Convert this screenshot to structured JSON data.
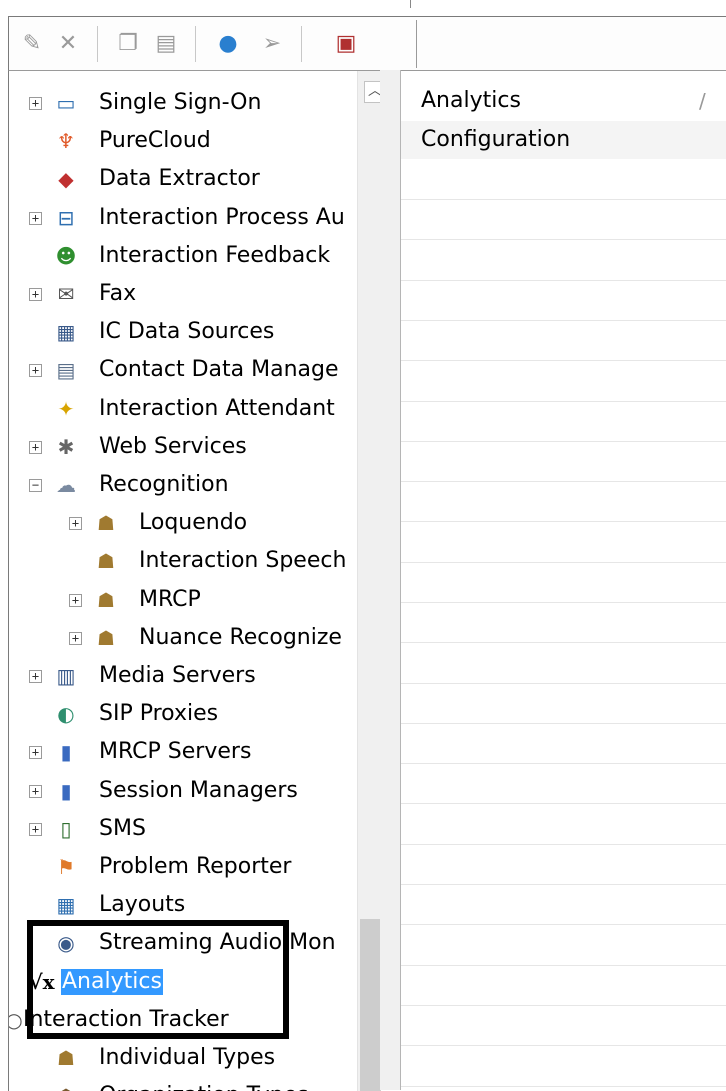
{
  "toolbar": {
    "icons": [
      "edit-icon",
      "delete-icon",
      "copy-icon",
      "paste-icon",
      "globe-icon",
      "flag-icon",
      "report-icon"
    ]
  },
  "tree": {
    "items": [
      {
        "label": "Single Sign-On",
        "icon": "sign-on-icon",
        "expandable": true
      },
      {
        "label": "PureCloud",
        "icon": "purecloud-icon",
        "expandable": false
      },
      {
        "label": "Data Extractor",
        "icon": "data-extractor-icon",
        "expandable": false
      },
      {
        "label": "Interaction Process Au",
        "icon": "process-flow-icon",
        "expandable": true
      },
      {
        "label": "Interaction Feedback",
        "icon": "feedback-users-icon",
        "expandable": false
      },
      {
        "label": "Fax",
        "icon": "fax-icon",
        "expandable": true
      },
      {
        "label": "IC Data Sources",
        "icon": "data-sources-icon",
        "expandable": false
      },
      {
        "label": "Contact Data Manage",
        "icon": "contact-data-icon",
        "expandable": true
      },
      {
        "label": "Interaction Attendant",
        "icon": "attendant-icon",
        "expandable": false
      },
      {
        "label": "Web Services",
        "icon": "web-services-icon",
        "expandable": true
      },
      {
        "label": "Recognition",
        "icon": "recognition-icon",
        "expandable": true,
        "expanded": true
      },
      {
        "label": "Loquendo",
        "icon": "speech-user-icon",
        "expandable": true,
        "child": true
      },
      {
        "label": "Interaction Speech",
        "icon": "speech-user-icon",
        "expandable": false,
        "child": true
      },
      {
        "label": "MRCP",
        "icon": "speech-user-icon",
        "expandable": true,
        "child": true
      },
      {
        "label": "Nuance Recognize",
        "icon": "speech-user-icon",
        "expandable": true,
        "child": true
      },
      {
        "label": "Media Servers",
        "icon": "media-server-icon",
        "expandable": true
      },
      {
        "label": "SIP Proxies",
        "icon": "sip-proxy-icon",
        "expandable": false
      },
      {
        "label": "MRCP Servers",
        "icon": "server-icon",
        "expandable": true
      },
      {
        "label": "Session Managers",
        "icon": "server-icon",
        "expandable": true
      },
      {
        "label": "SMS",
        "icon": "phone-icon",
        "expandable": true
      },
      {
        "label": "Problem Reporter",
        "icon": "problem-reporter-icon",
        "expandable": false
      },
      {
        "label": "Layouts",
        "icon": "layouts-icon",
        "expandable": false
      },
      {
        "label": "Streaming Audio Mon",
        "icon": "streaming-audio-icon",
        "expandable": false
      },
      {
        "label": "Analytics",
        "icon": "sqrt-x-icon",
        "expandable": false,
        "selected": true
      },
      {
        "label": "Interaction Tracker",
        "icon": "tracker-icon",
        "expandable": false
      },
      {
        "label": "Individual Types",
        "icon": "individual-types-icon",
        "expandable": false
      },
      {
        "label": "Organization Types",
        "icon": "organization-types-icon",
        "expandable": false
      }
    ]
  },
  "list": {
    "header": "Analytics",
    "header_divider": "/",
    "rows": [
      "Configuration"
    ]
  },
  "colors": {
    "selection": "#3399ff",
    "border": "#7a7a7a",
    "scrollbar": "#f0f0f0"
  }
}
